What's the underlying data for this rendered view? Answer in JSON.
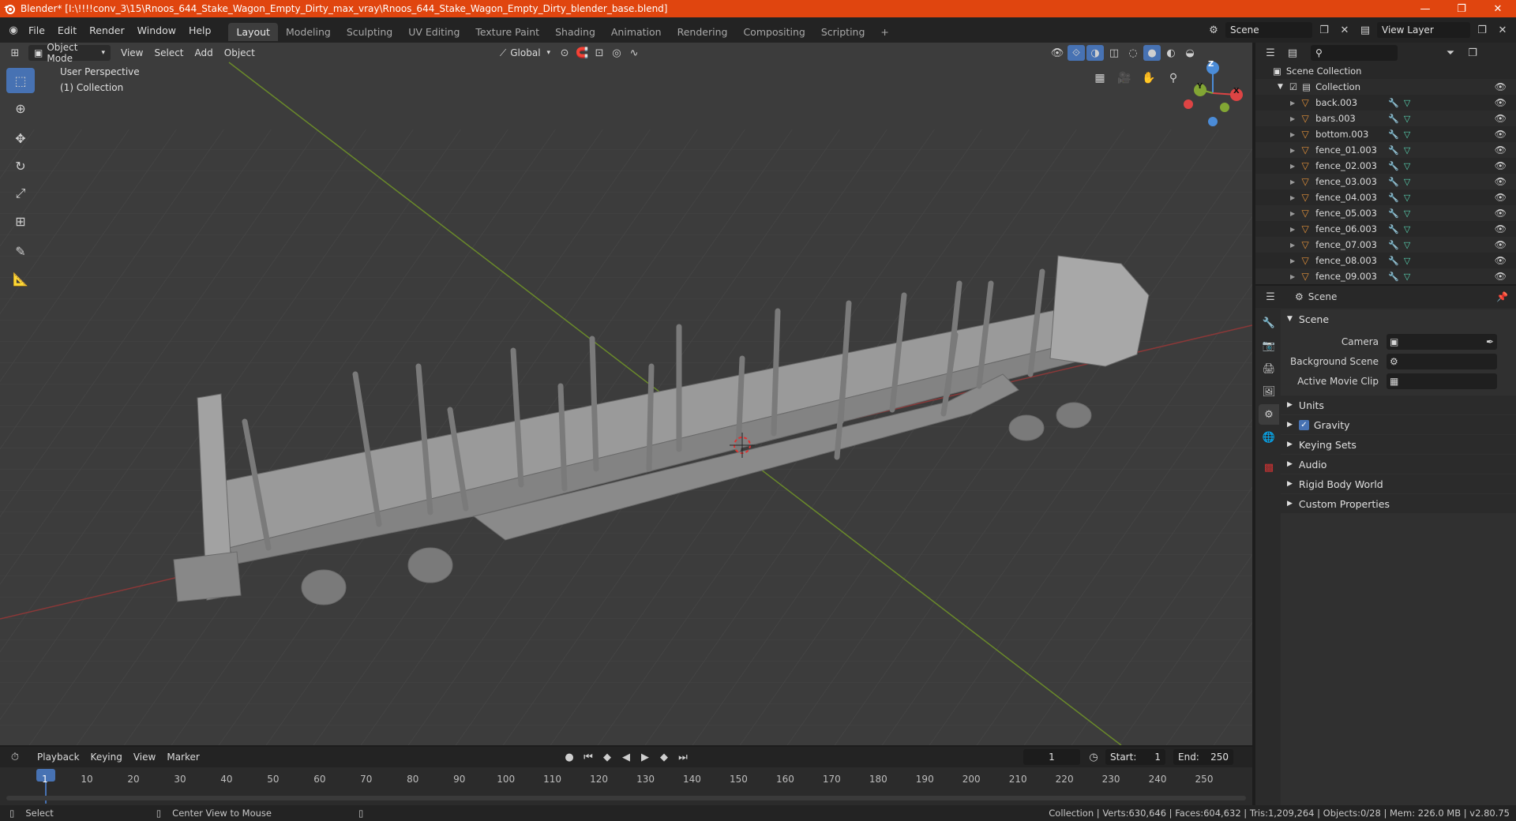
{
  "window": {
    "title": "Blender* [I:\\!!!!conv_3\\15\\Rnoos_644_Stake_Wagon_Empty_Dirty_max_vray\\Rnoos_644_Stake_Wagon_Empty_Dirty_blender_base.blend]",
    "controls": [
      "—",
      "❐",
      "✕"
    ]
  },
  "menu": [
    "File",
    "Edit",
    "Render",
    "Window",
    "Help"
  ],
  "workspaces": [
    "Layout",
    "Modeling",
    "Sculpting",
    "UV Editing",
    "Texture Paint",
    "Shading",
    "Animation",
    "Rendering",
    "Compositing",
    "Scripting"
  ],
  "workspace_add": "+",
  "scene_field": "Scene",
  "view_layer_field": "View Layer",
  "viewport_header": {
    "mode": "Object Mode",
    "menus": [
      "View",
      "Select",
      "Add",
      "Object"
    ],
    "orientation": "Global"
  },
  "viewport": {
    "perspective_label": "User Perspective",
    "collection_label": "(1) Collection",
    "gizmo_axes": [
      "Z",
      "Y",
      "X"
    ]
  },
  "outliner": {
    "search_placeholder": "",
    "scene_collection": "Scene Collection",
    "collection": "Collection",
    "objects": [
      "back.003",
      "bars.003",
      "bottom.003",
      "fence_01.003",
      "fence_02.003",
      "fence_03.003",
      "fence_04.003",
      "fence_05.003",
      "fence_06.003",
      "fence_07.003",
      "fence_08.003",
      "fence_09.003"
    ]
  },
  "properties": {
    "header": "Scene",
    "panel_title": "Scene",
    "fields": [
      {
        "label": "Camera",
        "value": ""
      },
      {
        "label": "Background Scene",
        "value": ""
      },
      {
        "label": "Active Movie Clip",
        "value": ""
      }
    ],
    "panels": [
      "Units",
      "Gravity",
      "Keying Sets",
      "Audio",
      "Rigid Body World",
      "Custom Properties"
    ],
    "gravity_checked": true
  },
  "timeline": {
    "menus": [
      "Playback",
      "Keying",
      "View",
      "Marker"
    ],
    "current_frame": "1",
    "start_label": "Start:",
    "start": "1",
    "end_label": "End:",
    "end": "250",
    "ticks": [
      "1",
      "10",
      "20",
      "30",
      "40",
      "50",
      "60",
      "70",
      "80",
      "90",
      "100",
      "110",
      "120",
      "130",
      "140",
      "150",
      "160",
      "170",
      "180",
      "190",
      "200",
      "210",
      "220",
      "230",
      "240",
      "250"
    ]
  },
  "status": {
    "select": "Select",
    "center_view": "Center View to Mouse",
    "stats": "Collection | Verts:630,646 | Faces:604,632 | Tris:1,209,264 | Objects:0/28 | Mem: 226.0 MB | v2.80.75"
  },
  "colors": {
    "titlebar": "#e0450f",
    "accent": "#4772b3",
    "object_icon": "#e2913a",
    "modifier_icon": "#80aeef",
    "mesh_data_icon": "#58d1b0"
  }
}
